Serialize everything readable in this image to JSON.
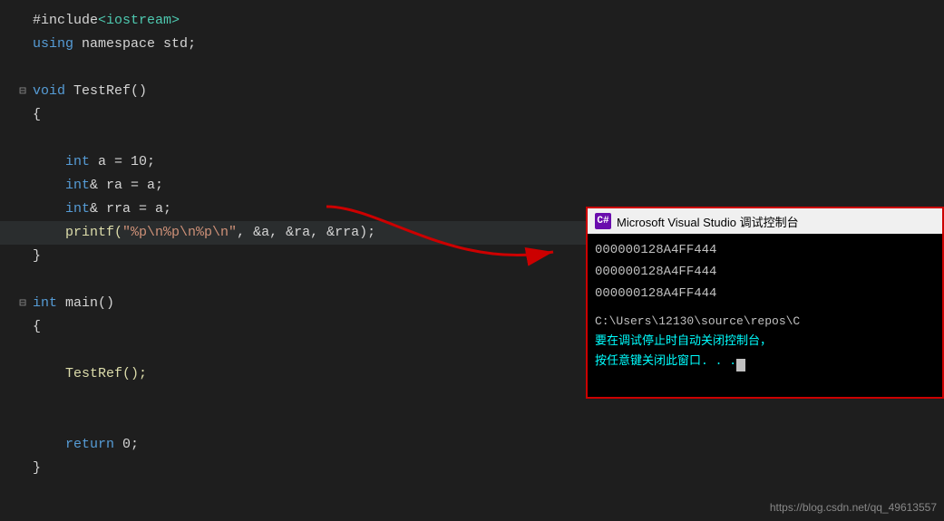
{
  "editor": {
    "lines": [
      {
        "num": "",
        "collapse": "",
        "indent": 0,
        "tokens": [
          {
            "text": "#include",
            "class": "include-color"
          },
          {
            "text": "<iostream>",
            "class": "kw-green"
          }
        ]
      },
      {
        "num": "",
        "collapse": "",
        "indent": 0,
        "tokens": [
          {
            "text": "using",
            "class": "namespace-kw"
          },
          {
            "text": " namespace ",
            "class": "include-color"
          },
          {
            "text": "std",
            "class": "include-color"
          },
          {
            "text": ";",
            "class": "include-color"
          }
        ]
      },
      {
        "num": "",
        "collapse": "",
        "indent": 0,
        "tokens": []
      },
      {
        "num": "",
        "collapse": "⊟",
        "indent": 0,
        "tokens": [
          {
            "text": "void",
            "class": "kw-blue"
          },
          {
            "text": " TestRef()",
            "class": "include-color"
          }
        ]
      },
      {
        "num": "",
        "collapse": "",
        "indent": 0,
        "tokens": [
          {
            "text": "{",
            "class": "include-color"
          }
        ]
      },
      {
        "num": "",
        "collapse": "",
        "indent": 1,
        "tokens": []
      },
      {
        "num": "",
        "collapse": "",
        "indent": 1,
        "tokens": [
          {
            "text": "int",
            "class": "kw-blue"
          },
          {
            "text": " a = 10;",
            "class": "include-color"
          }
        ]
      },
      {
        "num": "",
        "collapse": "",
        "indent": 1,
        "tokens": [
          {
            "text": "int",
            "class": "kw-blue"
          },
          {
            "text": "& ra = a;",
            "class": "include-color"
          }
        ]
      },
      {
        "num": "",
        "collapse": "",
        "indent": 1,
        "tokens": [
          {
            "text": "int",
            "class": "kw-blue"
          },
          {
            "text": "& rra = a;",
            "class": "include-color"
          }
        ]
      },
      {
        "num": "",
        "collapse": "",
        "indent": 1,
        "highlight": true,
        "tokens": [
          {
            "text": "printf(",
            "class": "fn-yellow"
          },
          {
            "text": "\"%p\\n%p\\n%p\\n\"",
            "class": "printf-str"
          },
          {
            "text": ", &a, &ra, &rra);",
            "class": "include-color"
          }
        ]
      },
      {
        "num": "",
        "collapse": "",
        "indent": 0,
        "tokens": [
          {
            "text": "}",
            "class": "include-color"
          }
        ]
      },
      {
        "num": "",
        "collapse": "",
        "indent": 0,
        "tokens": []
      },
      {
        "num": "",
        "collapse": "⊟",
        "indent": 0,
        "tokens": [
          {
            "text": "int",
            "class": "kw-blue"
          },
          {
            "text": " main()",
            "class": "include-color"
          }
        ]
      },
      {
        "num": "",
        "collapse": "",
        "indent": 0,
        "tokens": [
          {
            "text": "{",
            "class": "include-color"
          }
        ]
      },
      {
        "num": "",
        "collapse": "",
        "indent": 1,
        "tokens": []
      },
      {
        "num": "",
        "collapse": "",
        "indent": 1,
        "tokens": [
          {
            "text": "TestRef();",
            "class": "fn-yellow"
          }
        ]
      },
      {
        "num": "",
        "collapse": "",
        "indent": 1,
        "tokens": []
      },
      {
        "num": "",
        "collapse": "",
        "indent": 1,
        "tokens": []
      },
      {
        "num": "",
        "collapse": "",
        "indent": 1,
        "tokens": [
          {
            "text": "return",
            "class": "kw-blue"
          },
          {
            "text": " 0;",
            "class": "include-color"
          }
        ]
      },
      {
        "num": "",
        "collapse": "",
        "indent": 0,
        "tokens": [
          {
            "text": "}",
            "class": "include-color"
          }
        ]
      }
    ]
  },
  "console": {
    "title": "Microsoft Visual Studio 调试控制台",
    "icon_label": "C#",
    "output_lines": [
      "000000128A4FF444",
      "000000128A4FF444",
      "000000128A4FF444"
    ],
    "path_line": "C:\\Users\\12130\\source\\repos\\C",
    "info_line1": "要在调试停止时自动关闭控制台，",
    "info_line2": "按任意键关闭此窗口. . ."
  },
  "watermark": {
    "text": "https://blog.csdn.net/qq_49613557"
  }
}
